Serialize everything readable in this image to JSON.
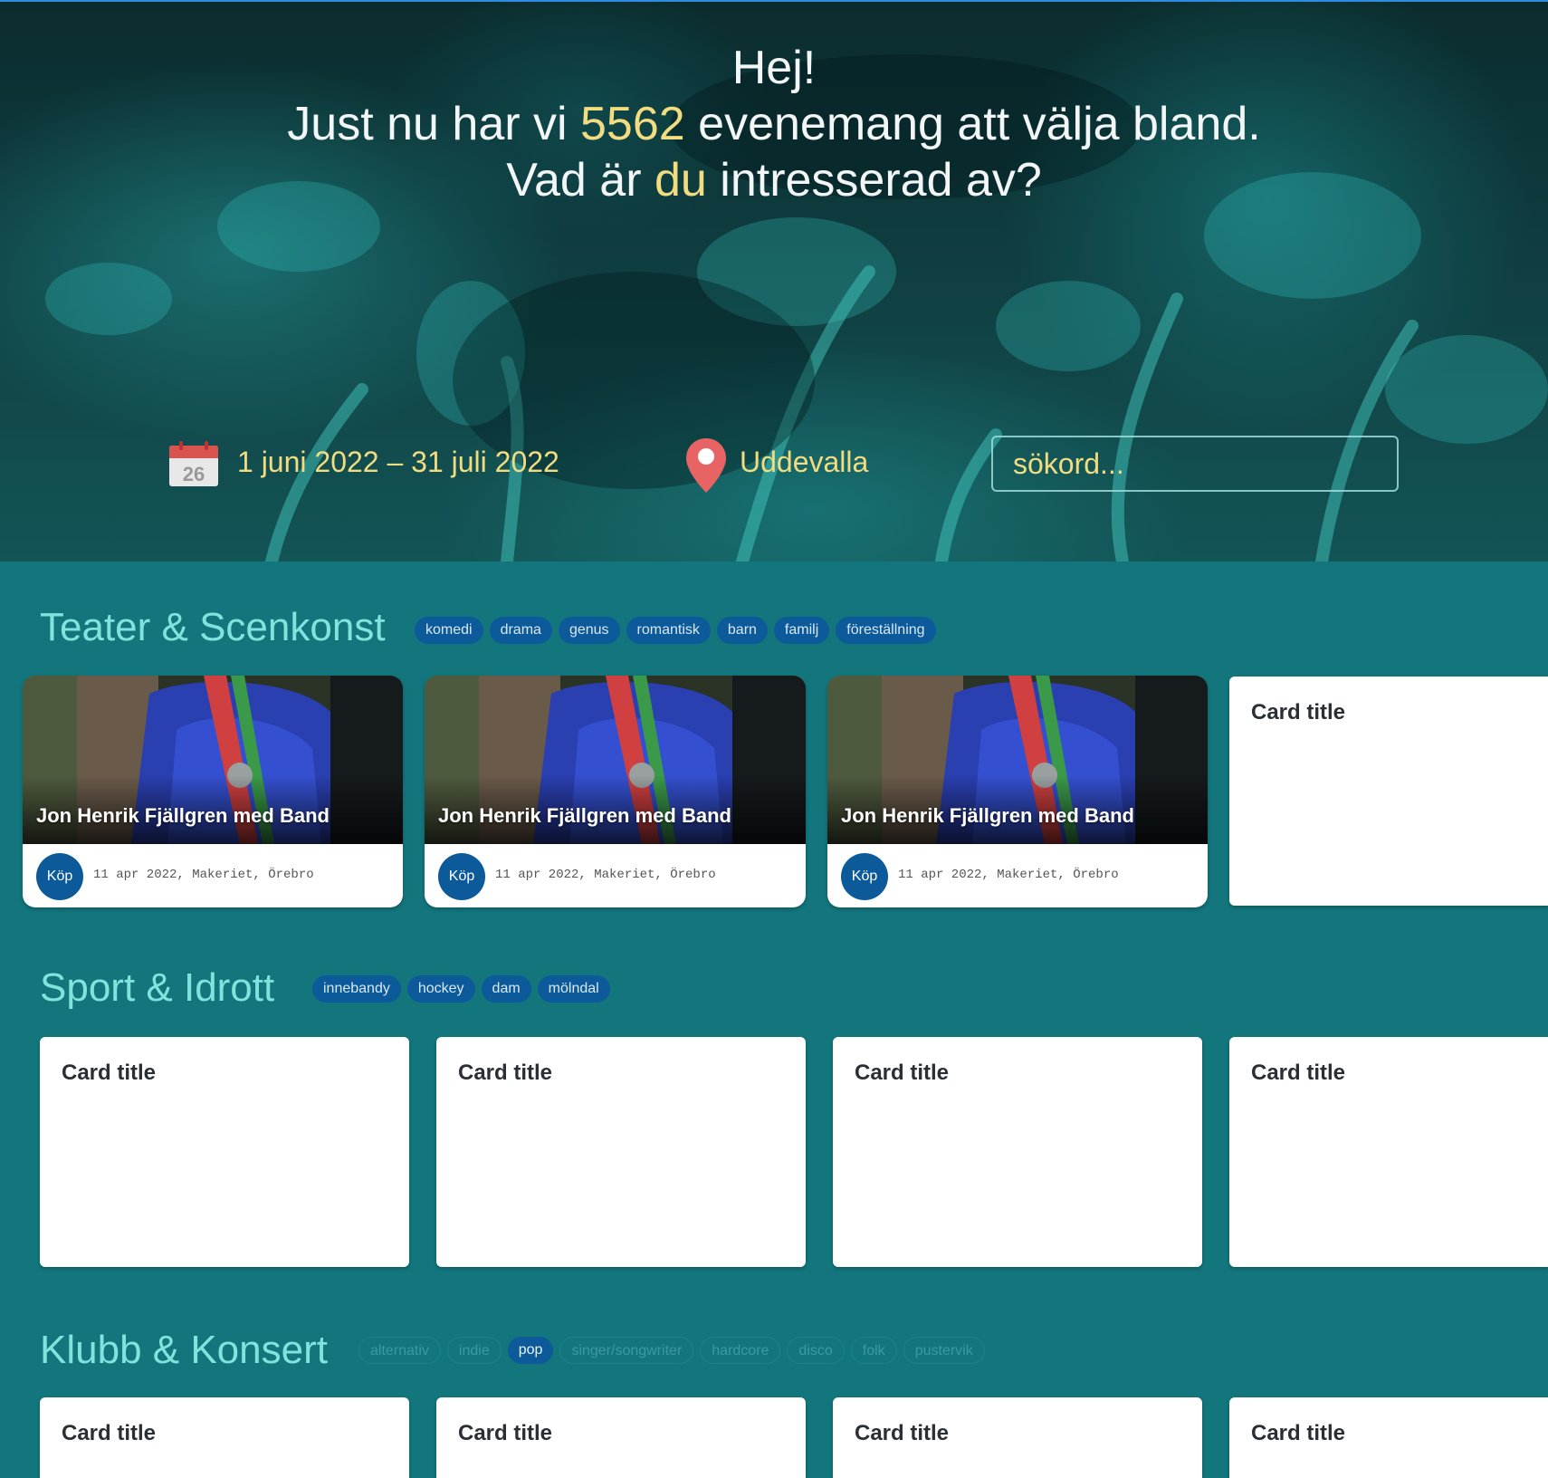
{
  "hero": {
    "greeting": "Hej!",
    "line2_pre": "Just nu har vi ",
    "event_count": "5562",
    "line2_post": " evenemang att välja bland.",
    "line3_pre": "Vad är ",
    "line3_highlight": "du",
    "line3_post": " intresserad av?"
  },
  "filters": {
    "calendar_day": "26",
    "date_range": "1 juni 2022 – 31 juli 2022",
    "city": "Uddevalla",
    "search_placeholder": "sökord..."
  },
  "colors": {
    "accent_yellow": "#f2dc80",
    "section_bg": "#13767d",
    "section_title": "#7fe4dc",
    "tag_blue": "#0c5a9a"
  },
  "sections": [
    {
      "title": "Teater & Scenkonst",
      "tags": [
        {
          "label": "komedi"
        },
        {
          "label": "drama"
        },
        {
          "label": "genus"
        },
        {
          "label": "romantisk"
        },
        {
          "label": "barn"
        },
        {
          "label": "familj"
        },
        {
          "label": "föreställning"
        }
      ],
      "events": [
        {
          "name": "Jon Henrik Fjällgren med Band",
          "buy_label": "Köp",
          "meta": "11 apr 2022, Makeriet, Örebro"
        },
        {
          "name": "Jon Henrik Fjällgren med Band",
          "buy_label": "Köp",
          "meta": "11 apr 2022, Makeriet, Örebro"
        },
        {
          "name": "Jon Henrik Fjällgren med Band",
          "buy_label": "Köp",
          "meta": "11 apr 2022, Makeriet, Örebro"
        }
      ],
      "cards": [
        {
          "title": "Card title"
        }
      ]
    },
    {
      "title": "Sport & Idrott",
      "tags": [
        {
          "label": "innebandy"
        },
        {
          "label": "hockey"
        },
        {
          "label": "dam"
        },
        {
          "label": "mölndal"
        }
      ],
      "cards": [
        {
          "title": "Card title"
        },
        {
          "title": "Card title"
        },
        {
          "title": "Card title"
        },
        {
          "title": "Card title"
        }
      ]
    },
    {
      "title": "Klubb & Konsert",
      "tags": [
        {
          "label": "alternativ",
          "state": "dim"
        },
        {
          "label": "indie",
          "state": "dim"
        },
        {
          "label": "pop",
          "state": "active"
        },
        {
          "label": "singer/songwriter",
          "state": "dim"
        },
        {
          "label": "hardcore",
          "state": "dim"
        },
        {
          "label": "disco",
          "state": "dim"
        },
        {
          "label": "folk",
          "state": "dim"
        },
        {
          "label": "pustervik",
          "state": "dim"
        }
      ],
      "cards": [
        {
          "title": "Card title"
        },
        {
          "title": "Card title"
        },
        {
          "title": "Card title"
        },
        {
          "title": "Card title"
        }
      ]
    }
  ]
}
